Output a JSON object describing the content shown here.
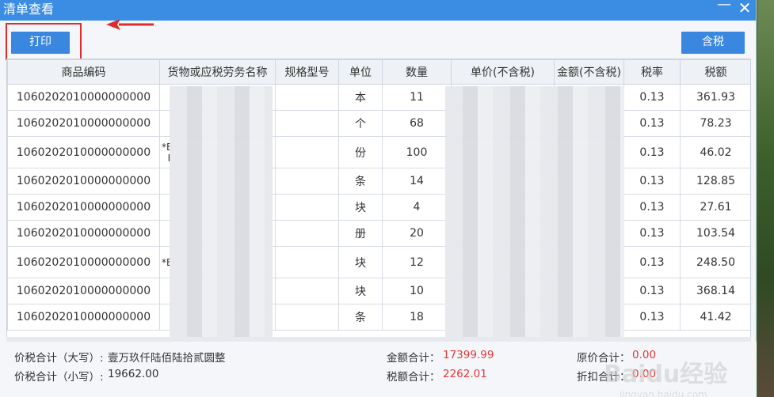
{
  "window": {
    "title": "清单查看",
    "min_glyph": "—",
    "close_glyph": "✕"
  },
  "toolbar": {
    "print_label": "打印",
    "tax_label": "含税"
  },
  "table": {
    "headers": [
      "商品编码",
      "货物或应税劳务名称",
      "规格型号",
      "单位",
      "数量",
      "单价(不含税)",
      "金额(不含税)",
      "税率",
      "税额"
    ],
    "rows": [
      {
        "code": "1060202010000000000",
        "name": "",
        "spec": "",
        "unit": "本",
        "qty": "11",
        "rate": "0.13",
        "tax": "361.93"
      },
      {
        "code": "1060202010000000000",
        "name": "",
        "spec": "",
        "unit": "个",
        "qty": "68",
        "rate": "0.13",
        "tax": "78.23"
      },
      {
        "code": "1060202010000000000",
        "name": "*E\n  I",
        "spec": "",
        "unit": "份",
        "qty": "100",
        "rate": "0.13",
        "tax": "46.02"
      },
      {
        "code": "1060202010000000000",
        "name": "",
        "spec": "",
        "unit": "条",
        "qty": "14",
        "rate": "0.13",
        "tax": "128.85"
      },
      {
        "code": "1060202010000000000",
        "name": "",
        "spec": "",
        "unit": "块",
        "qty": "4",
        "rate": "0.13",
        "tax": "27.61"
      },
      {
        "code": "1060202010000000000",
        "name": "",
        "spec": "",
        "unit": "册",
        "qty": "20",
        "rate": "0.13",
        "tax": "103.54"
      },
      {
        "code": "1060202010000000000",
        "name": "*E",
        "spec": "",
        "unit": "块",
        "qty": "12",
        "rate": "0.13",
        "tax": "248.50"
      },
      {
        "code": "1060202010000000000",
        "name": "",
        "spec": "",
        "unit": "块",
        "qty": "10",
        "rate": "0.13",
        "tax": "368.14"
      },
      {
        "code": "1060202010000000000",
        "name": "",
        "spec": "",
        "unit": "条",
        "qty": "18",
        "rate": "0.13",
        "tax": "41.42"
      }
    ]
  },
  "footer": {
    "total_upper_label": "价税合计（大写）:",
    "total_upper_value": "壹万玖仟陆佰陆拾贰圆整",
    "total_lower_label": "价税合计（小写）:",
    "total_lower_value": "19662.00",
    "amount_label": "金额合计：",
    "amount_value": "17399.99",
    "tax_total_label": "税额合计：",
    "tax_total_value": "2262.01",
    "orig_price_label": "原价合计：",
    "orig_price_value": "0.00",
    "discount_label": "折扣合计：",
    "discount_value": "0.00"
  },
  "watermark": {
    "text": "Baidu经验",
    "sub": "jingyan.baidu.com"
  },
  "colors": {
    "titlebar": "#3b8de4",
    "button": "#3a87e0",
    "highlight": "#e02b2b",
    "total_red": "#e23838"
  }
}
